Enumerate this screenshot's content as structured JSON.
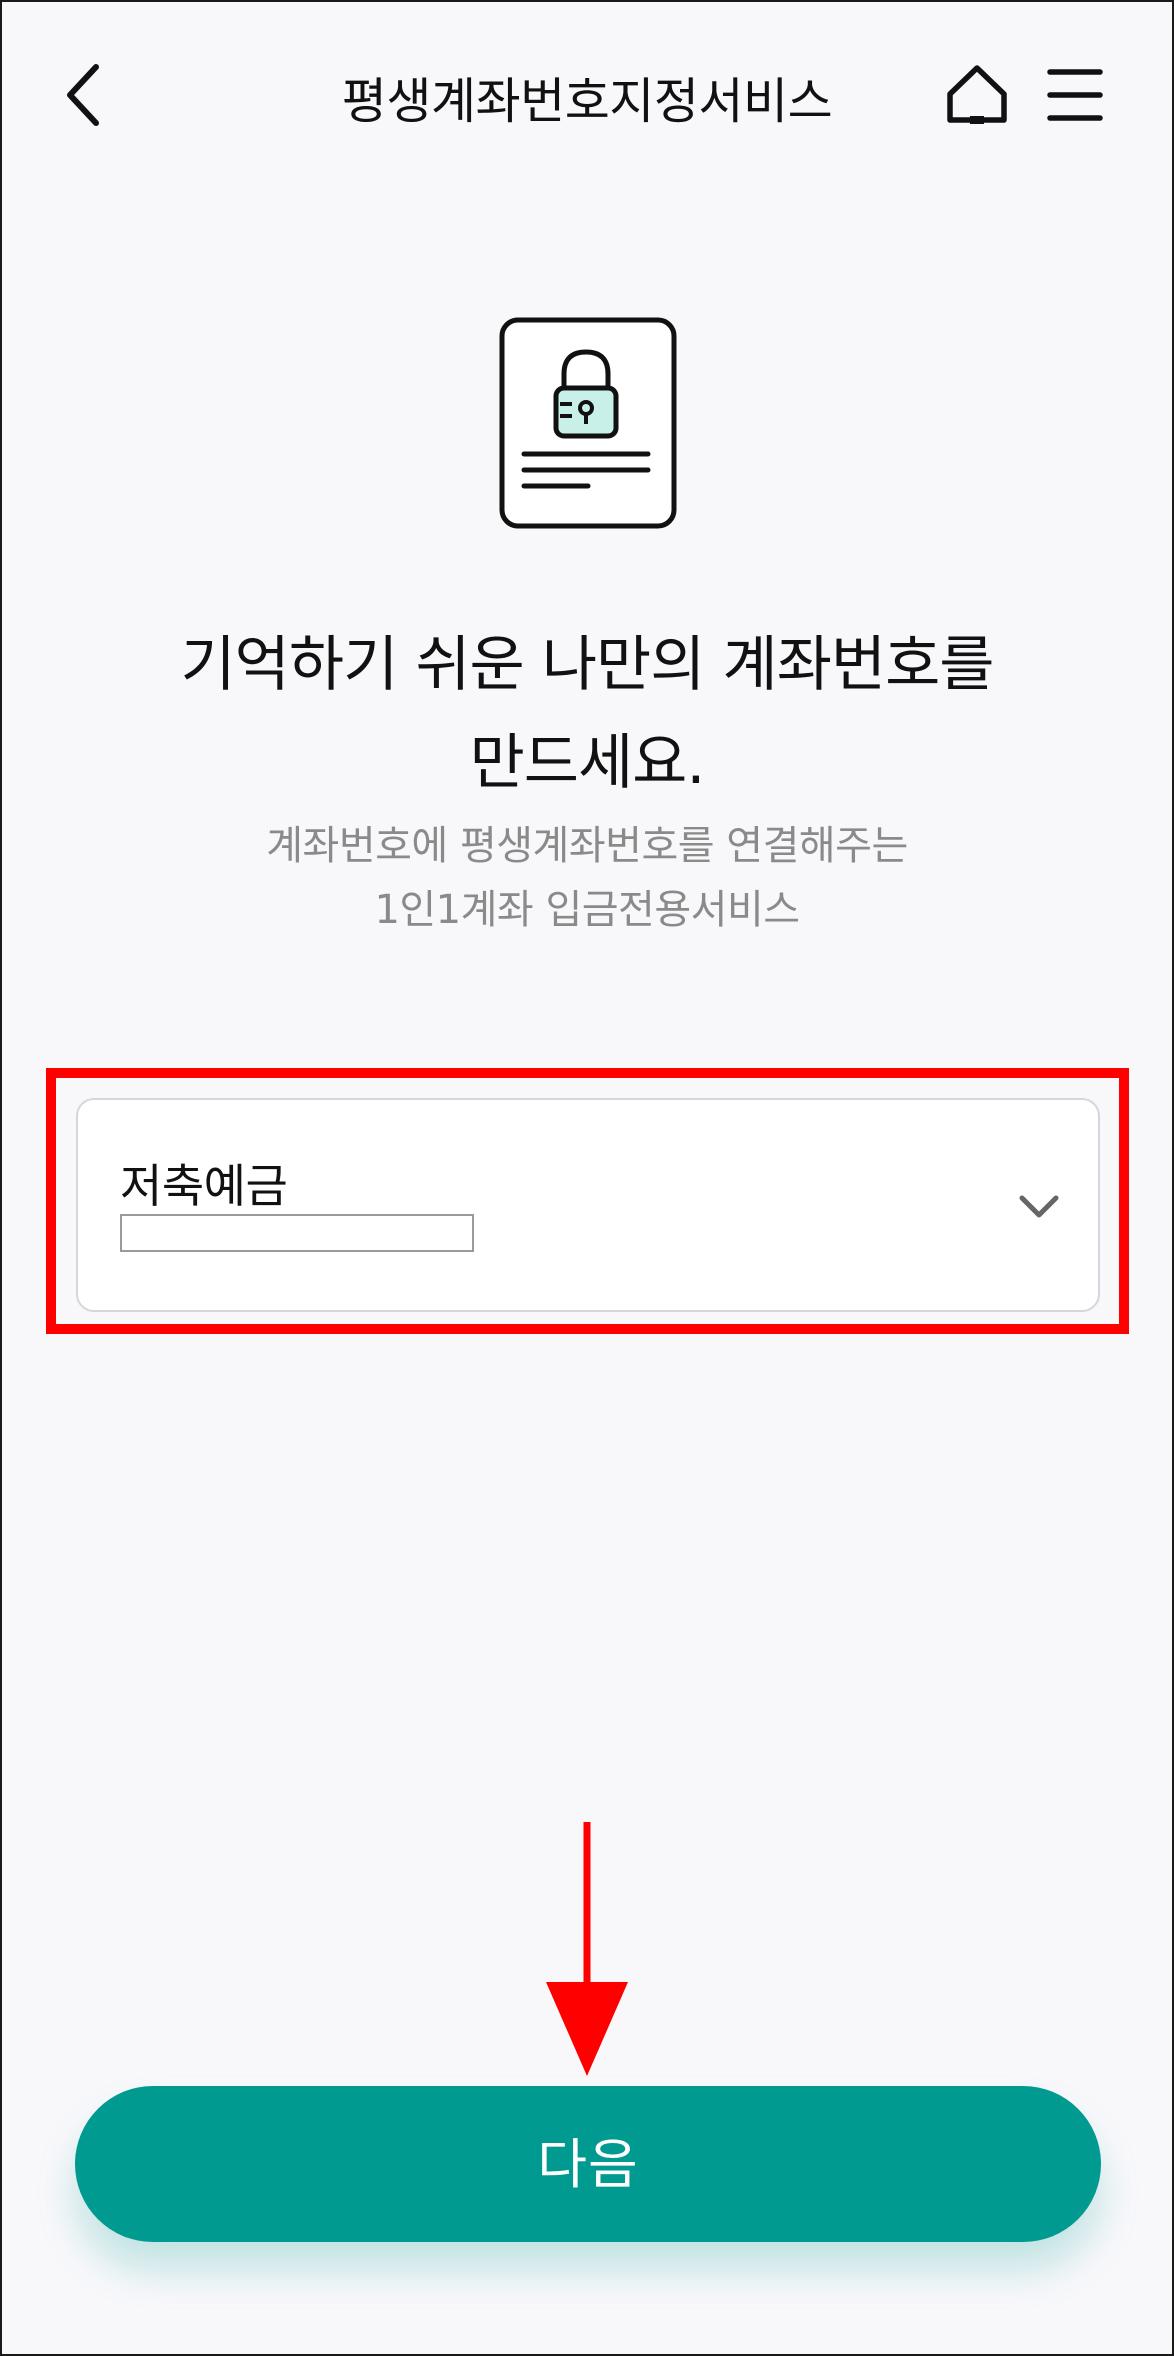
{
  "header": {
    "title": "평생계좌번호지정서비스",
    "back_icon": "chevron-left-icon",
    "home_icon": "home-icon",
    "menu_icon": "hamburger-menu-icon"
  },
  "illustration": {
    "icon": "locked-document-icon",
    "accent_color": "#c8f0e8"
  },
  "main": {
    "headline_line1": "기억하기 쉬운 나만의 계좌번호를",
    "headline_line2": "만드세요.",
    "subtext_line1": "계좌번호에 평생계좌번호를 연결해주는",
    "subtext_line2": "1인1계좌 입금전용서비스"
  },
  "account_select": {
    "account_type": "저축예금",
    "account_number": "",
    "dropdown_icon": "chevron-down-icon"
  },
  "footer": {
    "next_label": "다음"
  },
  "colors": {
    "primary": "#009a91",
    "highlight": "#ff0000",
    "background": "#f8f8fb"
  }
}
